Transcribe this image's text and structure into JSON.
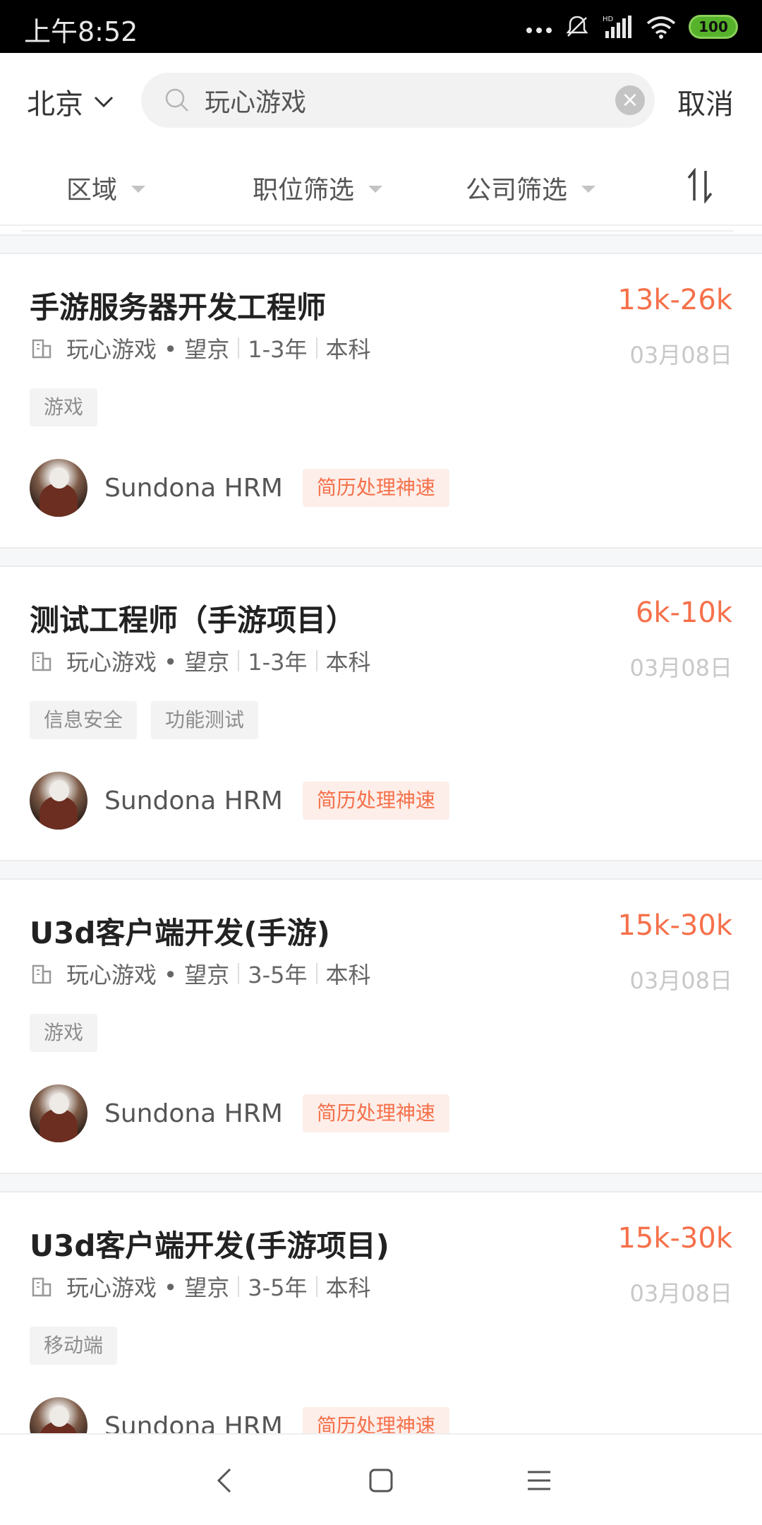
{
  "status_bar": {
    "time": "上午8:52",
    "battery": "100",
    "hd_label": "HD"
  },
  "header": {
    "city": "北京",
    "search_value": "玩心游戏",
    "cancel_label": "取消"
  },
  "filters": [
    {
      "label": "区域"
    },
    {
      "label": "职位筛选"
    },
    {
      "label": "公司筛选"
    }
  ],
  "jobs": [
    {
      "title": "手游服务器开发工程师",
      "salary": "13k-26k",
      "company": "玩心游戏 • 望京",
      "experience": "1-3年",
      "education": "本科",
      "date": "03月08日",
      "tags": [
        "游戏"
      ],
      "recruiter": "Sundona  HRM",
      "badge": "简历处理神速"
    },
    {
      "title": "测试工程师（手游项目）",
      "salary": "6k-10k",
      "company": "玩心游戏 • 望京",
      "experience": "1-3年",
      "education": "本科",
      "date": "03月08日",
      "tags": [
        "信息安全",
        "功能测试"
      ],
      "recruiter": "Sundona  HRM",
      "badge": "简历处理神速"
    },
    {
      "title": "U3d客户端开发(手游)",
      "salary": "15k-30k",
      "company": "玩心游戏 • 望京",
      "experience": "3-5年",
      "education": "本科",
      "date": "03月08日",
      "tags": [
        "游戏"
      ],
      "recruiter": "Sundona  HRM",
      "badge": "简历处理神速"
    },
    {
      "title": "U3d客户端开发(手游项目)",
      "salary": "15k-30k",
      "company": "玩心游戏 • 望京",
      "experience": "3-5年",
      "education": "本科",
      "date": "03月08日",
      "tags": [
        "移动端"
      ],
      "recruiter": "Sundona  HRM",
      "badge": "简历处理神速"
    }
  ],
  "colors": {
    "salary": "#f5704a",
    "badge_bg": "#fdeee9",
    "status_bar": "#000000"
  }
}
